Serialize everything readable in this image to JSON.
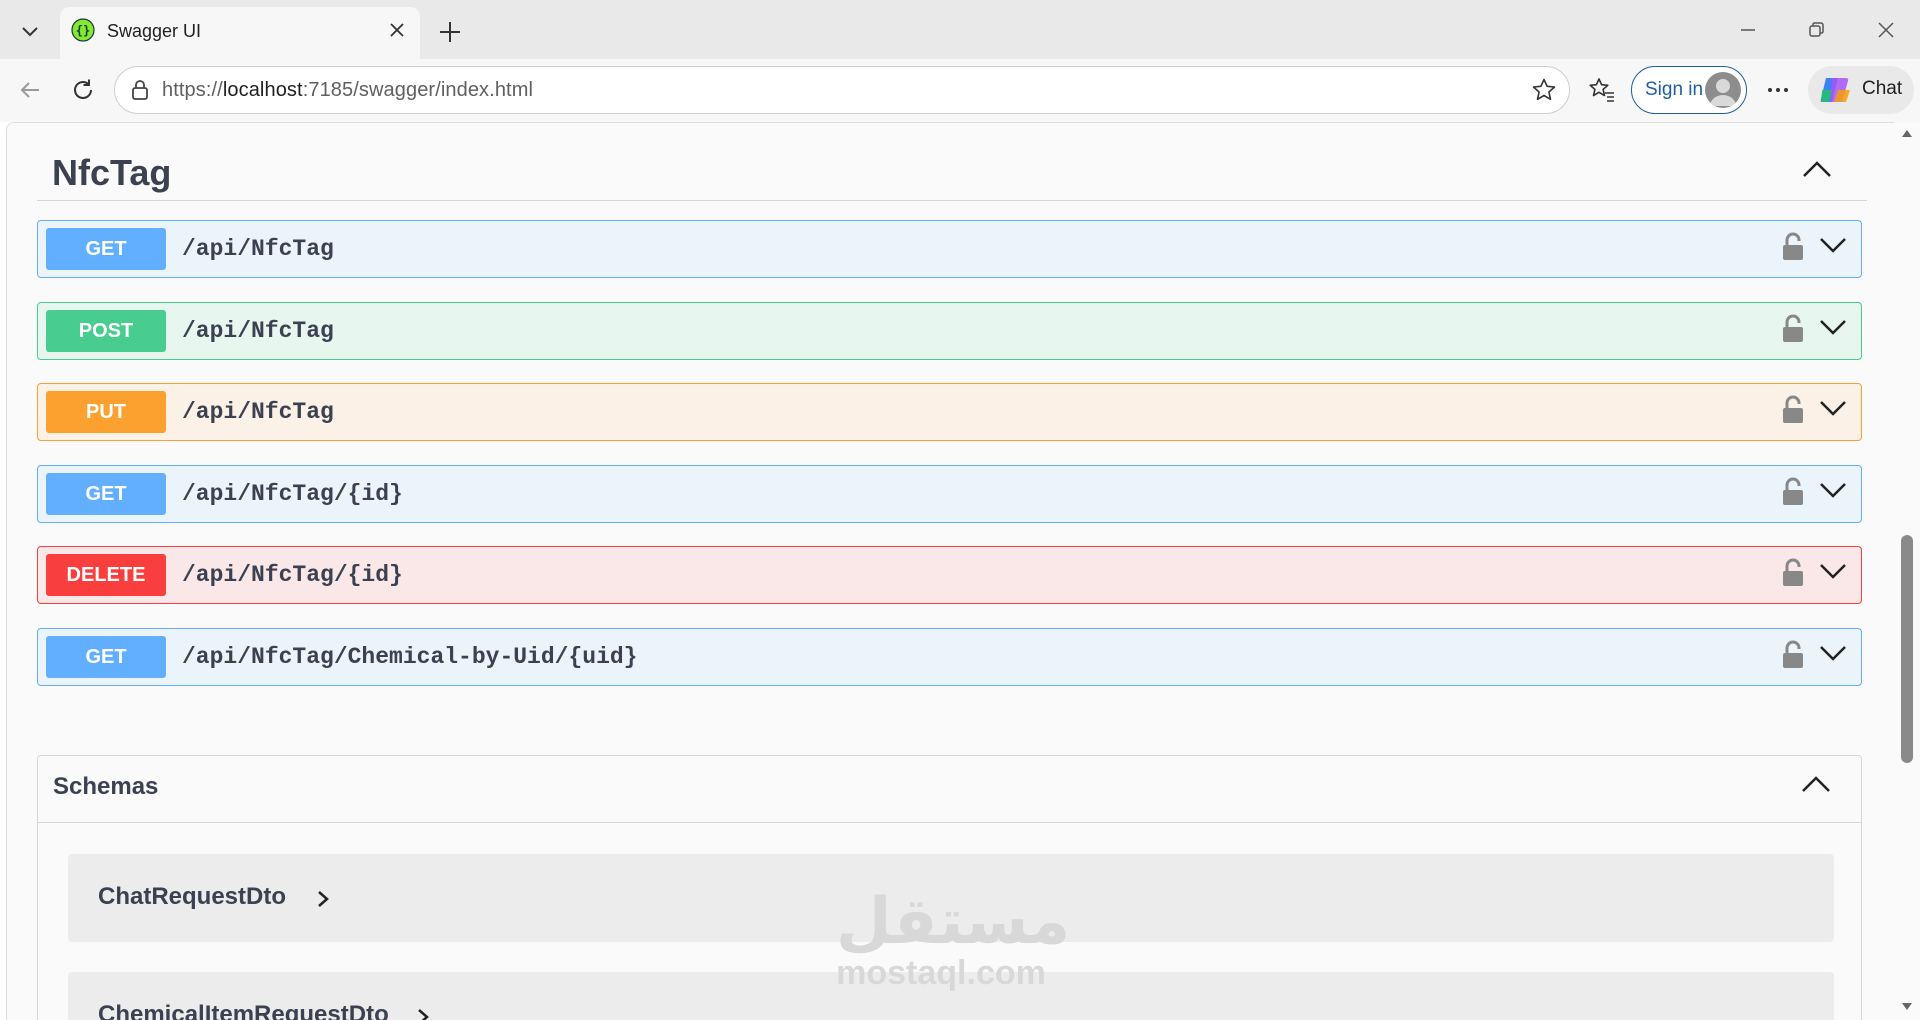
{
  "browser": {
    "tab_title": "Swagger UI",
    "url_scheme": "https://",
    "url_host": "localhost",
    "url_rest": ":7185/swagger/index.html",
    "signin_label": "Sign in",
    "chat_label": "Chat"
  },
  "section": {
    "title": "NfcTag"
  },
  "operations": [
    {
      "method": "GET",
      "path": "/api/NfcTag"
    },
    {
      "method": "POST",
      "path": "/api/NfcTag"
    },
    {
      "method": "PUT",
      "path": "/api/NfcTag"
    },
    {
      "method": "GET",
      "path": "/api/NfcTag/{id}"
    },
    {
      "method": "DELETE",
      "path": "/api/NfcTag/{id}"
    },
    {
      "method": "GET",
      "path": "/api/NfcTag/Chemical-by-Uid/{uid}"
    }
  ],
  "schemas": {
    "title": "Schemas",
    "models": [
      "ChatRequestDto",
      "ChemicalItemRequestDto"
    ]
  },
  "watermark": {
    "arabic": "مستقل",
    "latin": "mostaql.com"
  },
  "colors": {
    "get": "#61affe",
    "post": "#49cc90",
    "put": "#fca130",
    "delete": "#f93e3e",
    "signin_accent": "#1d5f9e"
  }
}
